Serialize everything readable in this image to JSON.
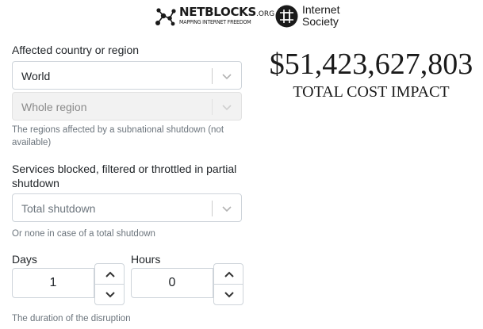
{
  "logos": {
    "netblocks": {
      "title": "NETBLOCKS",
      "tld": ".ORG",
      "tagline": "MAPPING INTERNET FREEDOM"
    },
    "internet_society": {
      "line1": "Internet",
      "line2": "Society"
    }
  },
  "form": {
    "country": {
      "label": "Affected country or region",
      "value": "World"
    },
    "region": {
      "placeholder": "Whole region",
      "disabled": true,
      "help": "The regions affected by a subnational shutdown (not available)"
    },
    "services": {
      "label_line1": "Services blocked, filtered or throttled in partial",
      "label_line2": "shutdown",
      "placeholder": "Total shutdown",
      "help": "Or none in case of a total shutdown"
    },
    "days": {
      "label": "Days",
      "value": "1"
    },
    "hours": {
      "label": "Hours",
      "value": "0"
    },
    "duration_help": "The duration of the disruption"
  },
  "result": {
    "amount": "$51,423,627,803",
    "caption": "TOTAL COST IMPACT"
  },
  "icons": {
    "dropdown": "chevron-down-icon",
    "increment": "chevron-up-icon",
    "decrement": "chevron-down-icon"
  }
}
